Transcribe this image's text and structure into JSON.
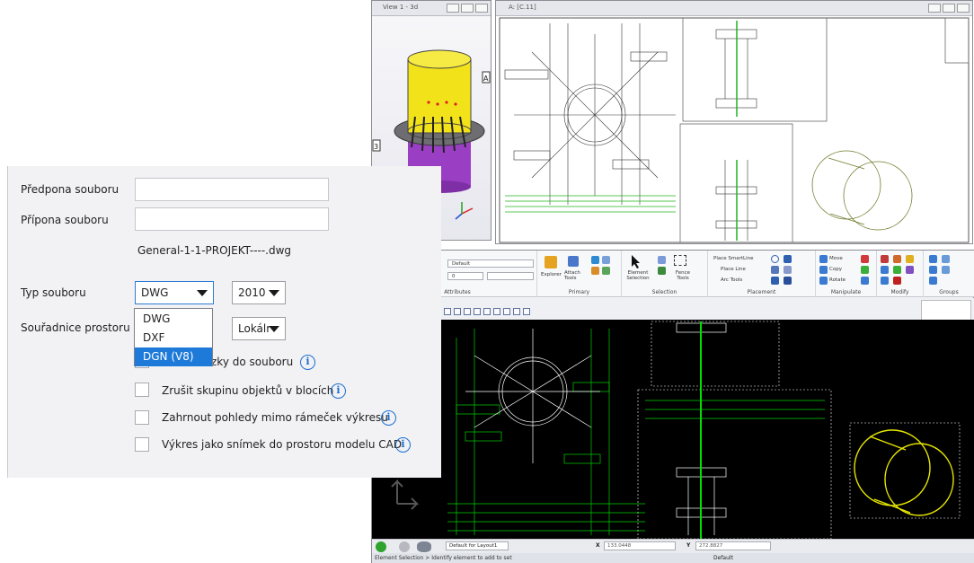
{
  "view3d": {
    "title": "View 1 - 3d",
    "tag_a": "A",
    "tag_3": "3"
  },
  "sheet": {
    "title": "A: [C.11]"
  },
  "ribbon": {
    "attributes_dropdown": "Default",
    "attributes_num": "0",
    "groups": {
      "attributes": "Attributes",
      "primary": "Primary",
      "selection": "Selection",
      "placement": "Placement",
      "manipulate": "Manipulate",
      "modify": "Modify",
      "groups": "Groups"
    },
    "explorer": "Explorer",
    "attach_tools": "Attach Tools",
    "element_selection": "Element Selection",
    "fence_tools": "Fence Tools",
    "place_smartline": "Place SmartLine",
    "place_line": "Place Line",
    "arc_tools": "Arc Tools",
    "move": "Move",
    "copy": "Copy",
    "rotate": "Rotate"
  },
  "statusbar": {
    "model": "Default for Layout1",
    "x_label": "X",
    "x_value": "133.0448",
    "y_label": "Y",
    "y_value": "272.8827",
    "level": "Default",
    "prompt": "Element Selection > Identify element to add to set"
  },
  "dialog": {
    "prefix_label": "Předpona souboru",
    "prefix_value": "",
    "suffix_label": "Přípona souboru",
    "suffix_value": "",
    "filename_preview": "General-1-1-PROJEKT----.dwg",
    "type_label": "Typ souboru",
    "type_value": "DWG",
    "type_options": [
      "DWG",
      "DXF",
      "DGN (V8)"
    ],
    "version_value": "2010",
    "coords_label": "Souřadnice prostoru m",
    "coords_value": "Lokálr",
    "checkboxes": [
      {
        "label": "zky do souboru",
        "checked": false
      },
      {
        "label": "Zrušit skupinu objektů v blocích",
        "checked": false
      },
      {
        "label": "Zahrnout pohledy mimo rámeček výkresu",
        "checked": false
      },
      {
        "label": "Výkres jako snímek do prostoru modelu CAD",
        "checked": false
      }
    ],
    "info_glyph": "i"
  },
  "colors": {
    "accent": "#1e7ad9",
    "cad_background": "#000000",
    "cad_green": "#00e000",
    "cad_yellow": "#e6e600",
    "model_yellow": "#f2e21a",
    "model_purple": "#9a3fc4"
  }
}
